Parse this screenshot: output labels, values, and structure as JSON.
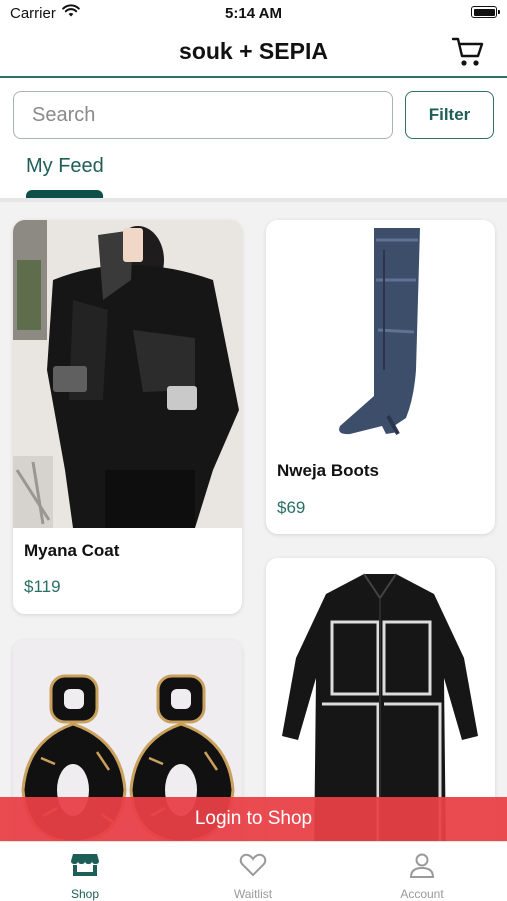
{
  "status_bar": {
    "carrier": "Carrier",
    "time": "5:14 AM"
  },
  "header": {
    "title": "souk + SEPIA"
  },
  "search": {
    "placeholder": "Search",
    "filter_label": "Filter"
  },
  "feed_tab": {
    "label": "My Feed"
  },
  "products": [
    {
      "name": "Myana Coat",
      "price": "$119"
    },
    {
      "name": "Nweja Boots",
      "price": "$69"
    }
  ],
  "login_banner": "Login to Shop",
  "tab_bar": [
    {
      "label": "Shop",
      "icon": "store-icon",
      "active": true
    },
    {
      "label": "Waitlist",
      "icon": "heart-icon",
      "active": false
    },
    {
      "label": "Account",
      "icon": "person-icon",
      "active": false
    }
  ],
  "colors": {
    "accent": "#1e5e57",
    "banner": "#e84046",
    "inactive": "#9a9a9a"
  }
}
